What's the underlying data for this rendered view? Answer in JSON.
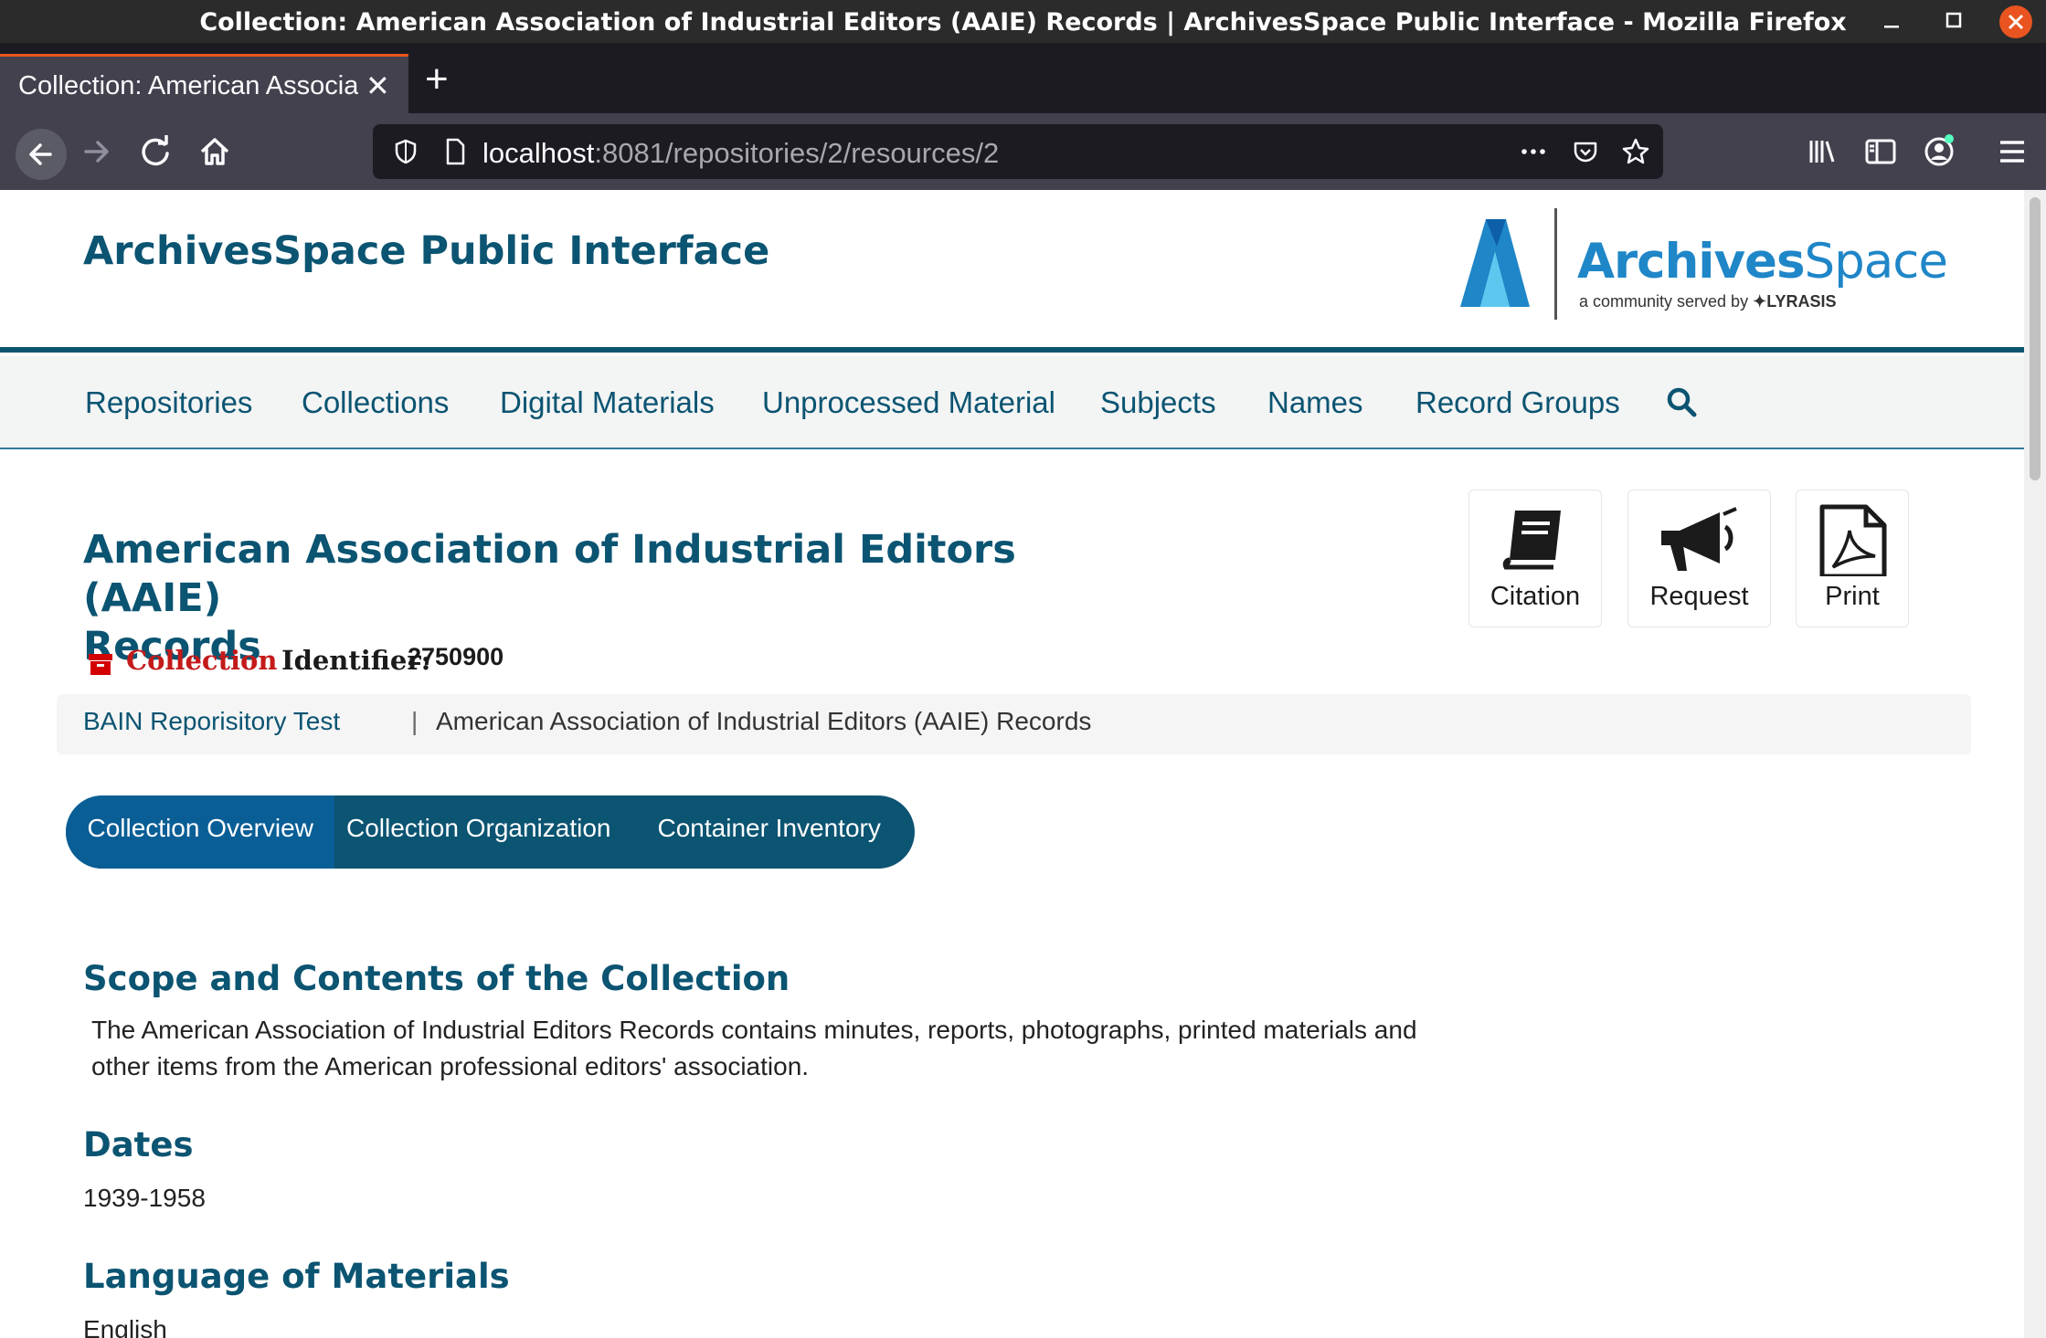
{
  "window": {
    "title": "Collection: American Association of Industrial Editors (AAIE) Records | ArchivesSpace Public Interface - Mozilla Firefox"
  },
  "browser": {
    "tab_title": "Collection: American Associa",
    "url_host": "localhost",
    "url_rest": ":8081/repositories/2/resources/2"
  },
  "site": {
    "title": "ArchivesSpace Public Interface",
    "logo": {
      "name_archives": "Archives",
      "name_space": "Space",
      "tagline": "a community served by",
      "partner": "LYRASIS"
    }
  },
  "nav": {
    "items": [
      "Repositories",
      "Collections",
      "Digital Materials",
      "Unprocessed Material",
      "Subjects",
      "Names",
      "Record Groups"
    ]
  },
  "record": {
    "title_line1": "American Association of Industrial Editors (AAIE)",
    "title_line2": "Records",
    "type": "Collection",
    "identifier_label": "Identifier:",
    "identifier": "2750900"
  },
  "actions": {
    "citation": "Citation",
    "request": "Request",
    "print": "Print"
  },
  "breadcrumb": {
    "repository": "BAIN Reporisitory Test",
    "separator": "|",
    "current": "American Association of Industrial Editors (AAIE) Records"
  },
  "record_tabs": [
    "Collection Overview",
    "Collection Organization",
    "Container Inventory"
  ],
  "sections": {
    "scope_heading": "Scope and Contents of the Collection",
    "scope_text": "The American Association of Industrial Editors Records contains minutes, reports, photographs, printed materials and other items from the American professional editors' association.",
    "dates_heading": "Dates",
    "dates_value": "1939-1958",
    "language_heading": "Language of Materials",
    "language_value": "English"
  },
  "colors": {
    "brand": "#0b5472",
    "accent_orange": "#e95420",
    "collection_red": "#c41a1a"
  }
}
